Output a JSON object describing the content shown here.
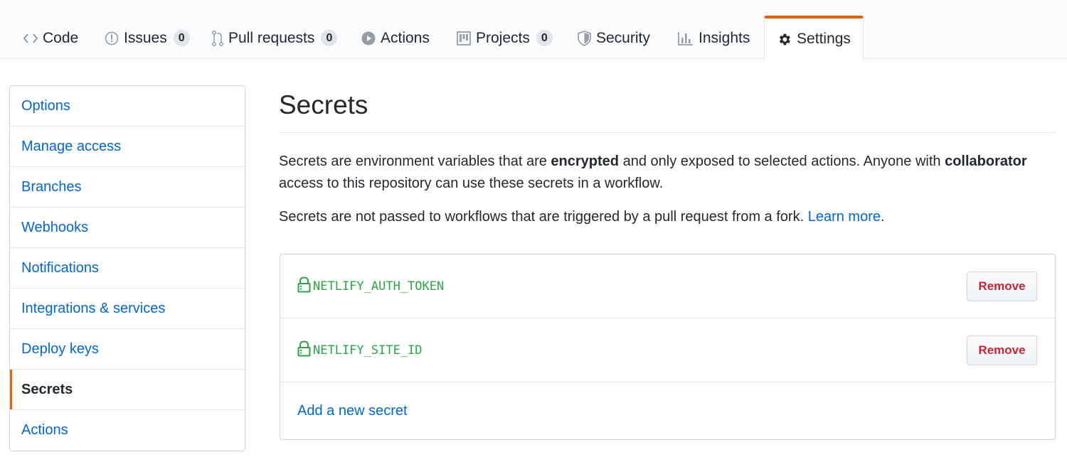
{
  "tabs": [
    {
      "label": "Code",
      "icon": "code-icon"
    },
    {
      "label": "Issues",
      "icon": "issue-icon",
      "count": "0"
    },
    {
      "label": "Pull requests",
      "icon": "pull-request-icon",
      "count": "0"
    },
    {
      "label": "Actions",
      "icon": "play-icon"
    },
    {
      "label": "Projects",
      "icon": "project-icon",
      "count": "0"
    },
    {
      "label": "Security",
      "icon": "shield-icon"
    },
    {
      "label": "Insights",
      "icon": "graph-icon"
    },
    {
      "label": "Settings",
      "icon": "gear-icon",
      "selected": true
    }
  ],
  "sidebar": {
    "items": [
      {
        "label": "Options"
      },
      {
        "label": "Manage access"
      },
      {
        "label": "Branches"
      },
      {
        "label": "Webhooks"
      },
      {
        "label": "Notifications"
      },
      {
        "label": "Integrations & services"
      },
      {
        "label": "Deploy keys"
      },
      {
        "label": "Secrets",
        "selected": true
      },
      {
        "label": "Actions"
      }
    ]
  },
  "main": {
    "title": "Secrets",
    "description": {
      "part1": "Secrets are environment variables that are ",
      "bold1": "encrypted",
      "part2": " and only exposed to selected actions. Anyone with ",
      "bold2": "collaborator",
      "part3": " access to this repository can use these secrets in a workflow."
    },
    "fork_note": {
      "text": "Secrets are not passed to workflows that are triggered by a pull request from a fork. ",
      "link": "Learn more",
      "end": "."
    },
    "secrets": [
      {
        "name": "NETLIFY_AUTH_TOKEN",
        "action": "Remove"
      },
      {
        "name": "NETLIFY_SITE_ID",
        "action": "Remove"
      }
    ],
    "add_link": "Add a new secret"
  },
  "colors": {
    "accent": "#e36209",
    "link": "#0366d6",
    "secret": "#28a745",
    "danger": "#cb2431"
  }
}
